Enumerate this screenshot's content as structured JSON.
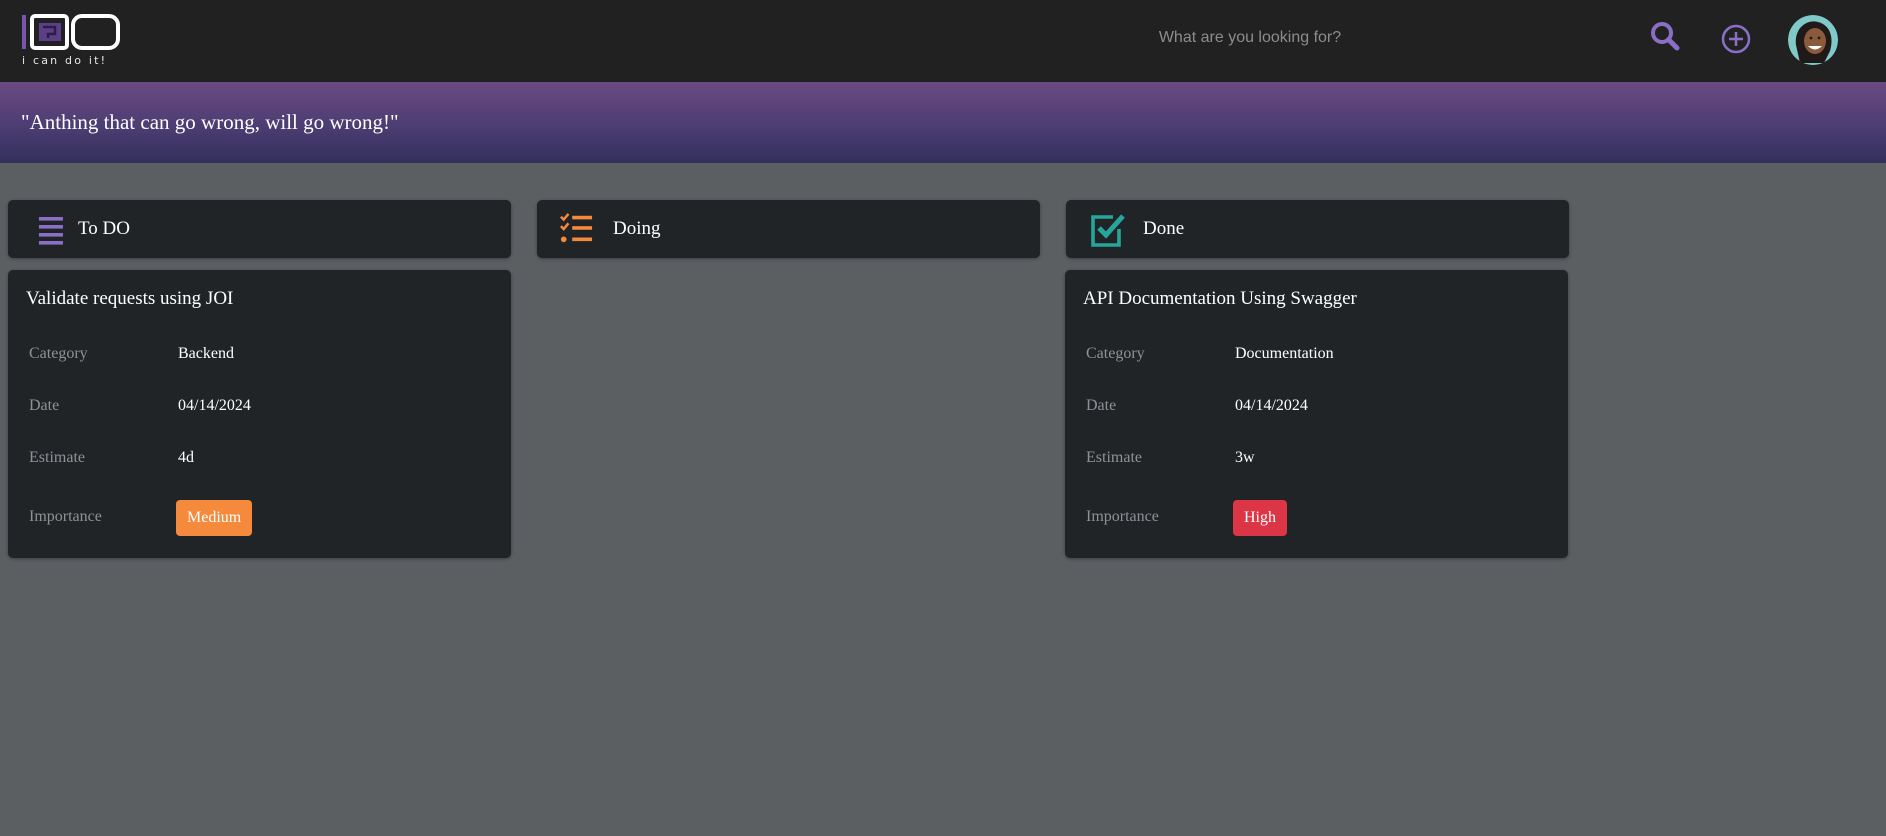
{
  "header": {
    "logo": {
      "text": "IDO",
      "tagline": "i can do it!"
    },
    "search": {
      "placeholder": "What are you looking for?",
      "value": ""
    },
    "icons": {
      "search": "search-icon",
      "add": "plus-circle-icon",
      "avatar": "user-avatar"
    }
  },
  "banner": {
    "quote": "\"Anthing that can go wrong, will go wrong!\""
  },
  "columns": [
    {
      "title": "To DO",
      "icon": "list-icon",
      "icon_color": "#8b6fc6"
    },
    {
      "title": "Doing",
      "icon": "checklist-icon",
      "icon_color": "#f58a3c"
    },
    {
      "title": "Done",
      "icon": "checkbox-checked-icon",
      "icon_color": "#26a69a"
    }
  ],
  "cards": {
    "todo": {
      "title": "Validate requests using JOI",
      "category_label": "Category",
      "category": "Backend",
      "date_label": "Date",
      "date": "04/14/2024",
      "estimate_label": "Estimate",
      "estimate": "4d",
      "importance_label": "Importance",
      "importance": "Medium",
      "importance_color": "#f58a3c"
    },
    "done": {
      "title": "API Documentation Using Swagger",
      "category_label": "Category",
      "category": "Documentation",
      "date_label": "Date",
      "date": "04/14/2024",
      "estimate_label": "Estimate",
      "estimate": "3w",
      "importance_label": "Importance",
      "importance": "High",
      "importance_color": "#dc3545"
    }
  },
  "colors": {
    "topbar": "#212121",
    "page_background": "#5b5f62",
    "card_background": "#212427",
    "banner_start": "#6a4a82",
    "banner_end": "#33305c"
  }
}
